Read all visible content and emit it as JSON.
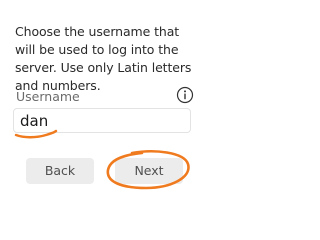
{
  "instructions": "Choose the username that will be used to log into the server. Use only Latin letters and numbers.",
  "username": {
    "label": "Username",
    "value": "dan",
    "info_icon": "info-icon"
  },
  "buttons": {
    "back_label": "Back",
    "next_label": "Next"
  },
  "annotation": {
    "color": "#f07a1e",
    "underline_target": "username-input",
    "circle_target": "next-button"
  },
  "colors": {
    "button_bg": "#ececec",
    "text": "#2a2a2a",
    "label": "#6b6b6b"
  }
}
